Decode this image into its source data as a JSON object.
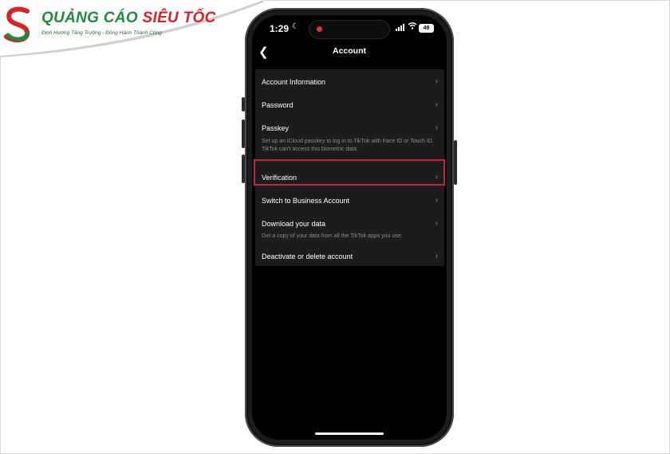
{
  "logo": {
    "brand_part1": "QUẢNG CÁO",
    "brand_part2": "SIÊU TỐC",
    "tagline": "Định Hướng Tăng Trưởng - Đồng Hành Thành Công",
    "colors": {
      "green": "#1f8a3a",
      "red": "#d6232a"
    }
  },
  "status_bar": {
    "time": "1:29",
    "focus_icon": "moon-icon",
    "battery": "49"
  },
  "nav": {
    "title": "Account",
    "back_icon": "chevron-left-icon"
  },
  "menu": [
    {
      "label": "Account Information"
    },
    {
      "label": "Password"
    },
    {
      "label": "Passkey",
      "description": "Set up an iCloud passkey to log in to TikTok with Face ID or Touch ID. TikTok can't access this biometric data."
    },
    {
      "label": "Verification",
      "highlighted": true
    },
    {
      "label": "Switch to Business Account"
    },
    {
      "label": "Download your data",
      "description": "Get a copy of your data from all the TikTok apps you use."
    },
    {
      "label": "Deactivate or delete account"
    }
  ],
  "colors": {
    "highlight": "#c5263a",
    "screen_bg": "#000000",
    "list_bg": "#1c1c1e"
  }
}
